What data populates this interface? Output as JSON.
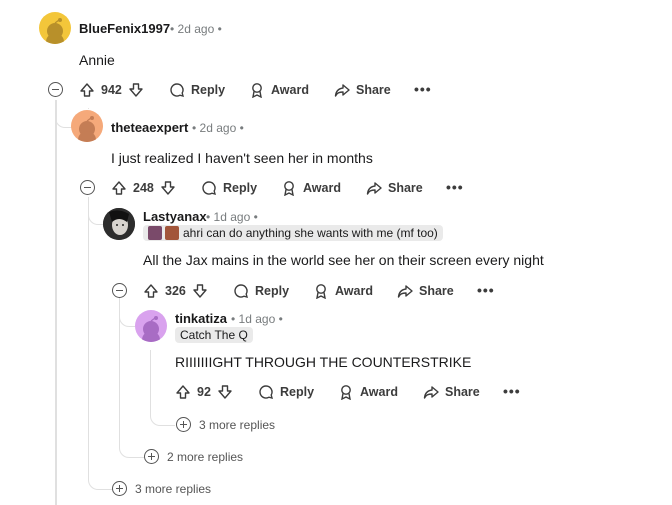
{
  "actions": {
    "reply": "Reply",
    "award": "Award",
    "share": "Share",
    "more": "•••"
  },
  "comments": [
    {
      "user": "BlueFenix1997",
      "meta": "• 2d ago •",
      "body": "Annie",
      "votes": "942",
      "avatar_color": "#f3c63a"
    },
    {
      "user": "theteaexpert",
      "meta": "• 2d ago •",
      "body": "I just realized I haven't seen her in months",
      "votes": "248",
      "avatar_color": "#f5a97a"
    },
    {
      "user": "Lastyanax",
      "meta": "• 1d ago •",
      "flair": "ahri can do anything she wants with me (mf too)",
      "body": "All the Jax mains in the world see her on their screen every night",
      "votes": "326",
      "avatar_color": "#3a3a3a"
    },
    {
      "user": "tinkatiza",
      "meta": "• 1d ago •",
      "flair": "Catch The Q",
      "body": "RIIIIIIIGHT THROUGH THE COUNTERSTRIKE",
      "votes": "92",
      "avatar_color": "#d9a2ee"
    }
  ],
  "more_replies": [
    "3 more replies",
    "2 more replies",
    "3 more replies"
  ]
}
